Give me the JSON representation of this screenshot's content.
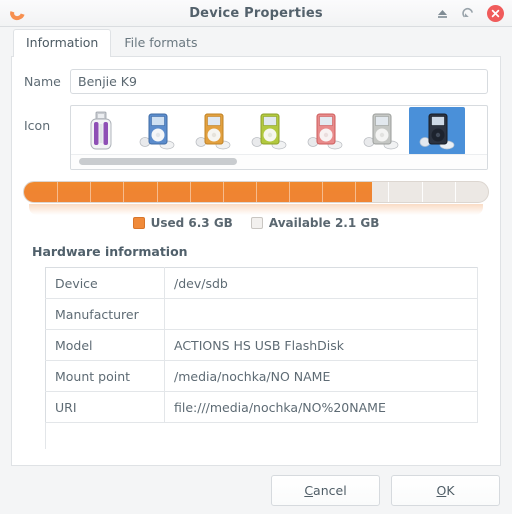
{
  "window": {
    "title": "Device Properties",
    "logo_icon": "banana-logo-icon",
    "controls": {
      "eject_label": "Eject",
      "eject_icon": "eject-icon",
      "restore_label": "Restore",
      "restore_icon": "restore-icon",
      "close_label": "Close",
      "close_icon": "close-icon"
    }
  },
  "tabs": [
    {
      "label": "Information",
      "active": true
    },
    {
      "label": "File formats",
      "active": false
    }
  ],
  "form": {
    "name_label": "Name",
    "name_value": "Benjie K9",
    "name_placeholder": "",
    "icon_label": "Icon"
  },
  "icons": [
    {
      "name": "usb-flash-drive-purple-icon",
      "selected": false
    },
    {
      "name": "ipod-blue-icon",
      "selected": false
    },
    {
      "name": "ipod-orange-icon",
      "selected": false
    },
    {
      "name": "ipod-green-icon",
      "selected": false
    },
    {
      "name": "ipod-red-icon",
      "selected": false
    },
    {
      "name": "ipod-silver-icon",
      "selected": false
    },
    {
      "name": "ipod-black-icon",
      "selected": true
    }
  ],
  "storage": {
    "used_percent": 75,
    "used_label": "Used 6.3 GB",
    "available_label": "Available 2.1 GB",
    "used_color": "#ef8431",
    "available_color": "#ece8e4"
  },
  "hardware": {
    "title": "Hardware information",
    "rows": [
      {
        "key": "Device",
        "value": "/dev/sdb"
      },
      {
        "key": "Manufacturer",
        "value": ""
      },
      {
        "key": "Model",
        "value": "ACTIONS HS USB FlashDisk"
      },
      {
        "key": "Mount point",
        "value": "/media/nochka/NO NAME"
      },
      {
        "key": "URI",
        "value": "file:///media/nochka/NO%20NAME"
      }
    ]
  },
  "footer": {
    "cancel_label": "Cancel",
    "cancel_mnemonic": "C",
    "ok_label": "OK",
    "ok_mnemonic": "O"
  }
}
